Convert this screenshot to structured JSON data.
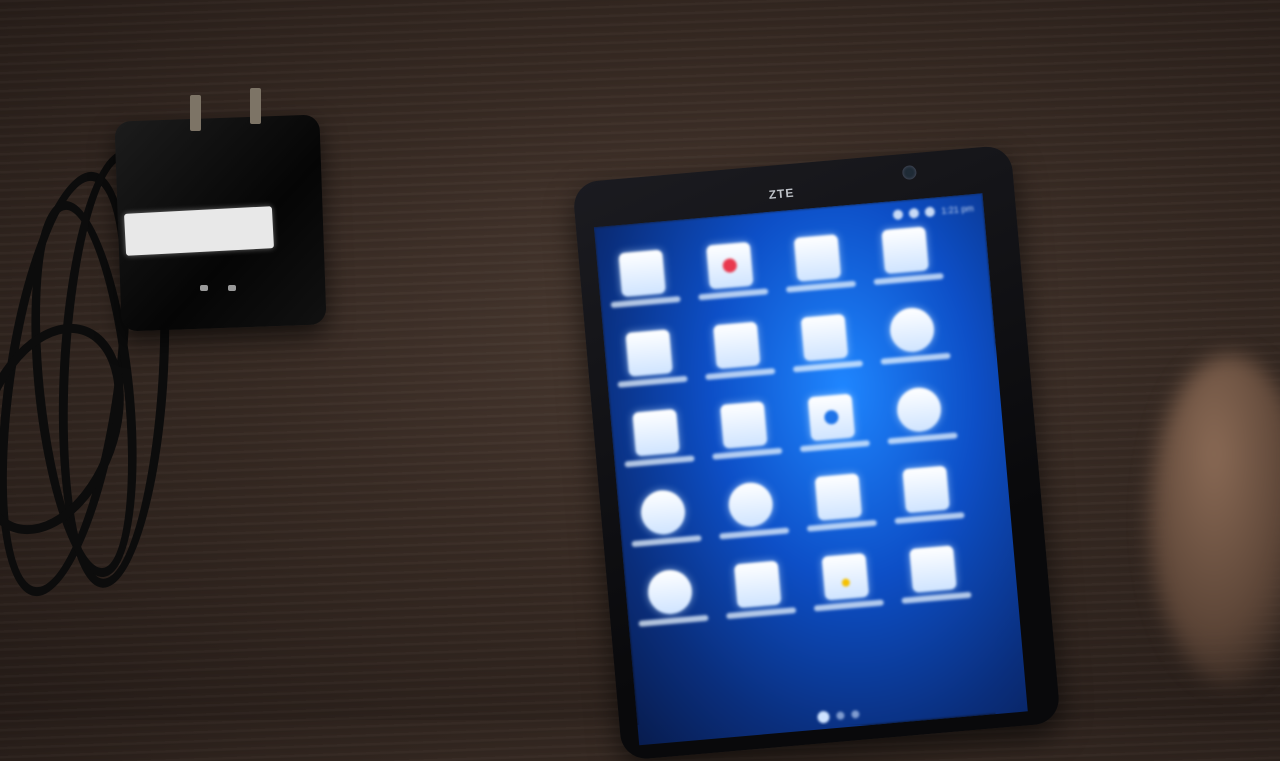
{
  "scene": {
    "phone_brand": "ZTE",
    "status_time": "1:21 pm",
    "apps": [
      {
        "icon": "app-icon"
      },
      {
        "icon": "record-icon"
      },
      {
        "icon": "app-icon"
      },
      {
        "icon": "app-icon"
      },
      {
        "icon": "app-icon"
      },
      {
        "icon": "app-icon"
      },
      {
        "icon": "app-icon"
      },
      {
        "icon": "globe-icon"
      },
      {
        "icon": "app-icon"
      },
      {
        "icon": "app-icon"
      },
      {
        "icon": "camera-icon"
      },
      {
        "icon": "globe-icon"
      },
      {
        "icon": "gear-icon"
      },
      {
        "icon": "gear-icon"
      },
      {
        "icon": "app-icon"
      },
      {
        "icon": "app-icon"
      },
      {
        "icon": "globe-icon"
      },
      {
        "icon": "app-icon"
      },
      {
        "icon": "app-icon"
      },
      {
        "icon": "app-icon"
      }
    ],
    "pages": 3,
    "active_page": 1,
    "colors": {
      "screen_blue": "#1f86ff",
      "table_wood": "#3a2c24",
      "charger_black": "#0b0b0b"
    }
  }
}
